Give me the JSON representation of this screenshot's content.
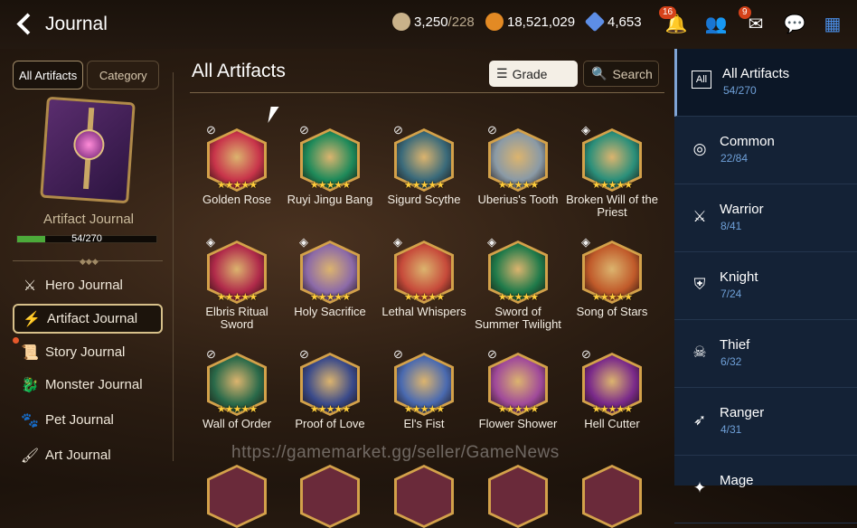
{
  "header": {
    "title": "Journal",
    "resources": [
      {
        "name": "stamina",
        "value": "3,250",
        "sub": "/228",
        "color": "#c9b28a"
      },
      {
        "name": "gold",
        "value": "18,521,029",
        "color": "#e38a24"
      },
      {
        "name": "crystal",
        "value": "4,653",
        "color": "#5d8ee6"
      }
    ],
    "bell_badge": "16",
    "mail_badge": "9"
  },
  "left": {
    "tabs": [
      "All Artifacts",
      "Category"
    ],
    "book_name": "Artifact Journal",
    "progress_text": "54/270",
    "progress": 0.2,
    "nav": [
      {
        "label": "Hero Journal",
        "icon": "hero-icon"
      },
      {
        "label": "Artifact Journal",
        "icon": "lightning-icon"
      },
      {
        "label": "Story Journal",
        "icon": "story-icon"
      },
      {
        "label": "Monster Journal",
        "icon": "monster-icon"
      },
      {
        "label": "Pet Journal",
        "icon": "paw-icon"
      },
      {
        "label": "Art Journal",
        "icon": "art-icon"
      }
    ]
  },
  "main": {
    "title": "All Artifacts",
    "grade_label": "Grade",
    "search_label": "Search",
    "artifacts": [
      {
        "name": "Golden Rose",
        "color": "#c8344a"
      },
      {
        "name": "Ruyi Jingu Bang",
        "color": "#1e8a5a"
      },
      {
        "name": "Sigurd Scythe",
        "color": "#3a6a7a"
      },
      {
        "name": "Uberius's Tooth",
        "color": "#8a9aa6"
      },
      {
        "name": "Broken Will of the Priest",
        "color": "#2a8f7a"
      },
      {
        "name": "Elbris Ritual Sword",
        "color": "#b02a4a"
      },
      {
        "name": "Holy Sacrifice",
        "color": "#8c6aa8"
      },
      {
        "name": "Lethal Whispers",
        "color": "#c64a3a"
      },
      {
        "name": "Sword of Summer Twilight",
        "color": "#1f7a4a"
      },
      {
        "name": "Song of Stars",
        "color": "#c05a2a"
      },
      {
        "name": "Wall of Order",
        "color": "#2a6a4a"
      },
      {
        "name": "Proof of Love",
        "color": "#3a4a8a"
      },
      {
        "name": "El's Fist",
        "color": "#4a6ab0"
      },
      {
        "name": "Flower Shower",
        "color": "#a04a9a"
      },
      {
        "name": "Hell Cutter",
        "color": "#7a2a8a"
      }
    ]
  },
  "right": {
    "categories": [
      {
        "name": "All Artifacts",
        "count": "54/270"
      },
      {
        "name": "Common",
        "count": "22/84"
      },
      {
        "name": "Warrior",
        "count": "8/41"
      },
      {
        "name": "Knight",
        "count": "7/24"
      },
      {
        "name": "Thief",
        "count": "6/32"
      },
      {
        "name": "Ranger",
        "count": "4/31"
      },
      {
        "name": "Mage",
        "count": ""
      }
    ]
  },
  "watermark": "https://gamemarket.gg/seller/GameNews"
}
